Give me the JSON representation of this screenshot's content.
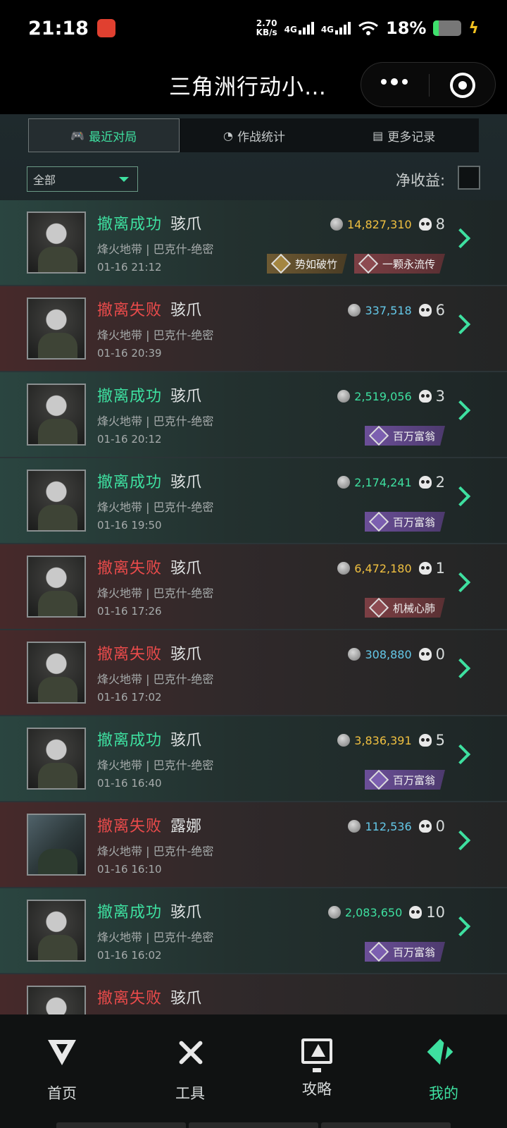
{
  "status_bar": {
    "time": "21:18",
    "speed_value": "2.70",
    "speed_unit": "KB/s",
    "network_1": "4G",
    "network_2": "4G",
    "battery_percent": "18%",
    "battery_level": 0.18,
    "icons": [
      "app-notification-icon",
      "signal-icon",
      "wifi-icon",
      "battery-icon",
      "charging-icon"
    ]
  },
  "title_bar": {
    "title": "三角洲行动小…",
    "icons": [
      "more-icon",
      "close-target-icon"
    ]
  },
  "tabs": [
    {
      "label": "最近对局",
      "icon": "gamepad-icon",
      "active": true
    },
    {
      "label": "作战统计",
      "icon": "pie-chart-icon",
      "active": false
    },
    {
      "label": "更多记录",
      "icon": "document-icon",
      "active": false
    }
  ],
  "filter": {
    "selected": "全部"
  },
  "net_income_label": "净收益:",
  "colors": {
    "success": "#3ee0a0",
    "fail": "#ea4b4b",
    "gold_amount": "#f0c040",
    "blue_amount": "#64c8e8",
    "green_amount": "#3ee0a0"
  },
  "matches": [
    {
      "result": "撤离成功",
      "outcome": "success",
      "operator": "骇爪",
      "map": "烽火地带 | 巴克什-绝密",
      "time": "01-16 21:12",
      "amount": "14,827,310",
      "amount_color": "gold",
      "kills": "8",
      "badges": [
        {
          "label": "势如破竹",
          "style": "gold"
        },
        {
          "label": "一颗永流传",
          "style": "red"
        }
      ]
    },
    {
      "result": "撤离失败",
      "outcome": "fail",
      "operator": "骇爪",
      "map": "烽火地带 | 巴克什-绝密",
      "time": "01-16 20:39",
      "amount": "337,518",
      "amount_color": "blue",
      "kills": "6",
      "badges": []
    },
    {
      "result": "撤离成功",
      "outcome": "success",
      "operator": "骇爪",
      "map": "烽火地带 | 巴克什-绝密",
      "time": "01-16 20:12",
      "amount": "2,519,056",
      "amount_color": "green",
      "kills": "3",
      "badges": [
        {
          "label": "百万富翁",
          "style": "purple"
        }
      ]
    },
    {
      "result": "撤离成功",
      "outcome": "success",
      "operator": "骇爪",
      "map": "烽火地带 | 巴克什-绝密",
      "time": "01-16 19:50",
      "amount": "2,174,241",
      "amount_color": "green",
      "kills": "2",
      "badges": [
        {
          "label": "百万富翁",
          "style": "purple"
        }
      ]
    },
    {
      "result": "撤离失败",
      "outcome": "fail",
      "operator": "骇爪",
      "map": "烽火地带 | 巴克什-绝密",
      "time": "01-16 17:26",
      "amount": "6,472,180",
      "amount_color": "gold",
      "kills": "1",
      "badges": [
        {
          "label": "机械心肺",
          "style": "red"
        }
      ]
    },
    {
      "result": "撤离失败",
      "outcome": "fail",
      "operator": "骇爪",
      "map": "烽火地带 | 巴克什-绝密",
      "time": "01-16 17:02",
      "amount": "308,880",
      "amount_color": "blue",
      "kills": "0",
      "badges": []
    },
    {
      "result": "撤离成功",
      "outcome": "success",
      "operator": "骇爪",
      "map": "烽火地带 | 巴克什-绝密",
      "time": "01-16 16:40",
      "amount": "3,836,391",
      "amount_color": "gold",
      "kills": "5",
      "badges": [
        {
          "label": "百万富翁",
          "style": "purple"
        }
      ]
    },
    {
      "result": "撤离失败",
      "outcome": "fail",
      "operator": "露娜",
      "map": "烽火地带 | 巴克什-绝密",
      "time": "01-16 16:10",
      "amount": "112,536",
      "amount_color": "blue",
      "kills": "0",
      "badges": []
    },
    {
      "result": "撤离成功",
      "outcome": "success",
      "operator": "骇爪",
      "map": "烽火地带 | 巴克什-绝密",
      "time": "01-16 16:02",
      "amount": "2,083,650",
      "amount_color": "green",
      "kills": "10",
      "badges": [
        {
          "label": "百万富翁",
          "style": "purple"
        }
      ]
    },
    {
      "result": "撤离失败",
      "outcome": "fail",
      "operator": "骇爪",
      "map": "",
      "time": "",
      "amount": "",
      "amount_color": "blue",
      "kills": "",
      "badges": []
    }
  ],
  "bottom_nav": [
    {
      "label": "首页",
      "icon": "home-logo-icon",
      "active": false
    },
    {
      "label": "工具",
      "icon": "tools-icon",
      "active": false
    },
    {
      "label": "攻略",
      "icon": "guide-monitor-icon",
      "active": false
    },
    {
      "label": "我的",
      "icon": "profile-logo-icon",
      "active": true
    }
  ]
}
